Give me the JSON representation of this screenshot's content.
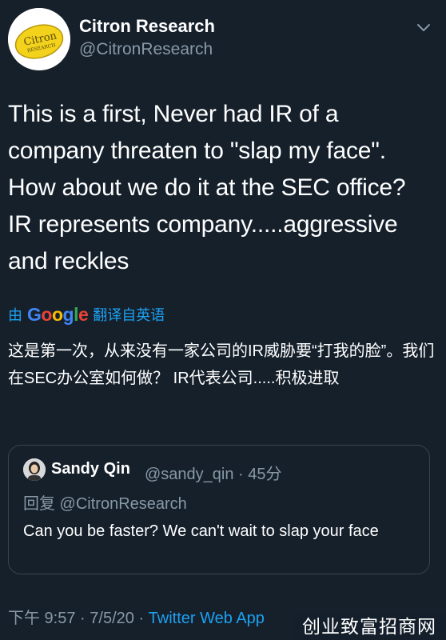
{
  "tweet": {
    "author_name": "Citron Research",
    "author_handle": "@CitronResearch",
    "avatar_logo_text": "Citron RESEARCH",
    "text": "This is a first, Never had IR of a company threaten to \"slap my face\". How about we do it at the SEC office? IR represents company.....aggressive and reckles",
    "translate": {
      "by_label": "由",
      "provider": "Google",
      "action_label": "翻译自英语"
    },
    "translated_text": "这是第一次，从来没有一家公司的IR威胁要“打我的脸”。我们在SEC办公室如何做？ IR代表公司.....积极进取"
  },
  "quoted_tweet": {
    "author_name": "Sandy Qin",
    "author_handle": "@sandy_qin",
    "separator": "·",
    "time_ago": "45分",
    "reply_to": "回复 @CitronResearch",
    "text": "Can you be faster? We can't wait to slap your face"
  },
  "footer": {
    "time": "下午 9:57",
    "date": "7/5/20",
    "app": "Twitter Web App"
  },
  "watermark": "创业致富招商网",
  "colors": {
    "background": "#15202b",
    "text_primary": "#ffffff",
    "text_secondary": "#8899a6",
    "accent": "#1da1f2",
    "border": "#38444d"
  }
}
